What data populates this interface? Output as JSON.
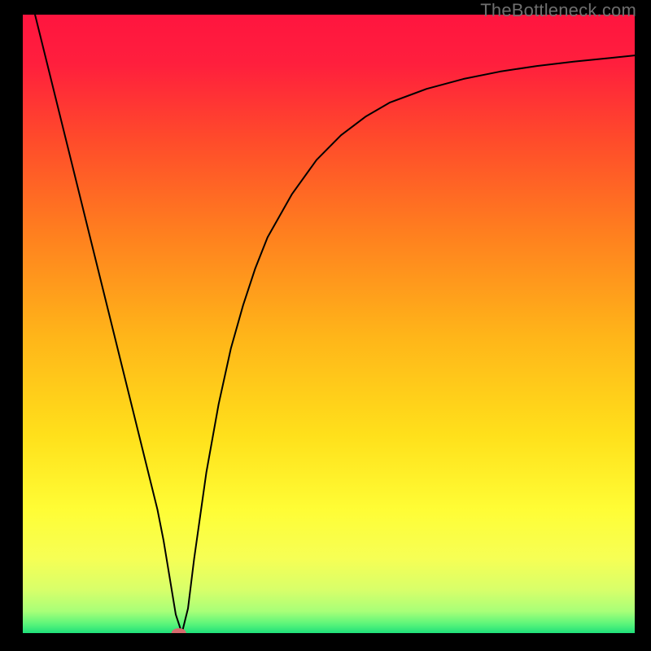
{
  "watermark": "TheBottleneck.com",
  "chart_data": {
    "type": "line",
    "title": "",
    "xlabel": "",
    "ylabel": "",
    "xlim": [
      0,
      100
    ],
    "ylim": [
      0,
      100
    ],
    "grid": false,
    "background_gradient": {
      "stops": [
        {
          "offset": 0.0,
          "color": "#ff153f"
        },
        {
          "offset": 0.08,
          "color": "#ff1f3d"
        },
        {
          "offset": 0.2,
          "color": "#ff4a2b"
        },
        {
          "offset": 0.35,
          "color": "#ff7e1f"
        },
        {
          "offset": 0.52,
          "color": "#ffb519"
        },
        {
          "offset": 0.68,
          "color": "#ffe01b"
        },
        {
          "offset": 0.8,
          "color": "#fffd35"
        },
        {
          "offset": 0.88,
          "color": "#f6ff55"
        },
        {
          "offset": 0.93,
          "color": "#d8ff6a"
        },
        {
          "offset": 0.965,
          "color": "#a8ff78"
        },
        {
          "offset": 0.985,
          "color": "#5cf57a"
        },
        {
          "offset": 1.0,
          "color": "#1fe07a"
        }
      ]
    },
    "series": [
      {
        "name": "bottleneck-curve",
        "stroke": "#000000",
        "stroke_width": 2,
        "x": [
          0,
          2,
          4,
          6,
          8,
          10,
          12,
          14,
          16,
          18,
          20,
          21,
          22,
          23,
          24,
          25,
          26,
          27,
          28,
          30,
          32,
          34,
          36,
          38,
          40,
          44,
          48,
          52,
          56,
          60,
          66,
          72,
          78,
          84,
          90,
          96,
          100
        ],
        "y": [
          108,
          100,
          92,
          84,
          76,
          68,
          60,
          52,
          44,
          36,
          28,
          24,
          20,
          15,
          9,
          3,
          0,
          4,
          12,
          26,
          37,
          46,
          53,
          59,
          64,
          71,
          76.5,
          80.5,
          83.5,
          85.8,
          88.0,
          89.6,
          90.8,
          91.7,
          92.4,
          93.0,
          93.4
        ]
      }
    ],
    "marker": {
      "name": "min-point",
      "x": 25.5,
      "y": 0,
      "rx": 9,
      "ry": 6,
      "fill": "#d76a6e"
    }
  }
}
